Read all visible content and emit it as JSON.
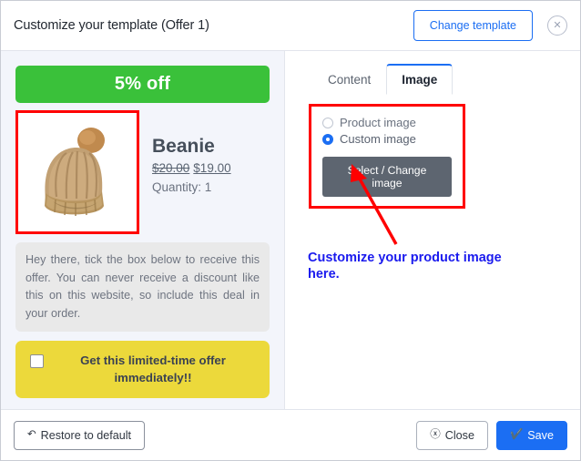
{
  "header": {
    "title": "Customize your template (Offer 1)",
    "change_template_label": "Change template",
    "close_icon": "close-circle-icon"
  },
  "offer_preview": {
    "banner_text": "5% off",
    "banner_color": "#3ac13a",
    "product": {
      "name": "Beanie",
      "price_old": "$20.00",
      "price_new": "$19.00",
      "quantity_label": "Quantity: 1",
      "image_alt": "knit-beanie-hat"
    },
    "description": "Hey there, tick the box below to receive this offer. You can never receive a discount like this on this website, so include this deal in your order.",
    "accept_text": "Get this limited-time offer immediately!!",
    "accept_color": "#ecd93b",
    "accept_checked": false
  },
  "settings": {
    "tabs": [
      {
        "label": "Content",
        "active": false
      },
      {
        "label": "Image",
        "active": true
      }
    ],
    "image_options": {
      "radios": [
        {
          "label": "Product image",
          "selected": false
        },
        {
          "label": "Custom image",
          "selected": true
        }
      ],
      "select_image_label": "Select / Change image"
    }
  },
  "annotation": {
    "text": "Customize your product image here.",
    "color": "#1a1aee",
    "arrow_color": "#ff0000"
  },
  "footer": {
    "restore_label": "Restore to default",
    "restore_icon": "undo-icon",
    "close_label": "Close",
    "close_icon": "close-circle-icon",
    "save_label": "Save",
    "save_icon": "check-circle-icon",
    "save_color": "#1b6ef3"
  }
}
